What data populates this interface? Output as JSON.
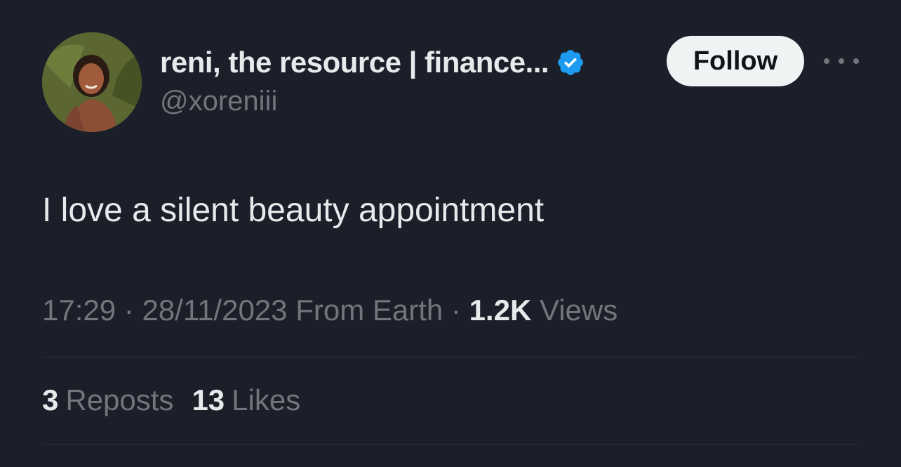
{
  "author": {
    "display_name": "reni, the resource | finance...",
    "handle": "@xoreniii",
    "verified": true,
    "verified_color": "#1d9bf0",
    "avatar_icon": "profile-photo"
  },
  "actions": {
    "follow_label": "Follow",
    "more_icon": "more-horizontal-icon"
  },
  "tweet": {
    "text": "I love a silent beauty appointment"
  },
  "meta": {
    "time": "17:29",
    "sep1": " · ",
    "date": "28/11/2023",
    "source": " From Earth",
    "sep2": " · ",
    "views_count": "1.2K",
    "views_label": " Views"
  },
  "stats": {
    "reposts_count": "3",
    "reposts_label": "Reposts",
    "likes_count": "13",
    "likes_label": "Likes"
  },
  "colors": {
    "background": "#1a1f2a",
    "text_primary": "#e7e9ea",
    "text_secondary": "#71767b",
    "follow_bg": "#eff3f4"
  }
}
